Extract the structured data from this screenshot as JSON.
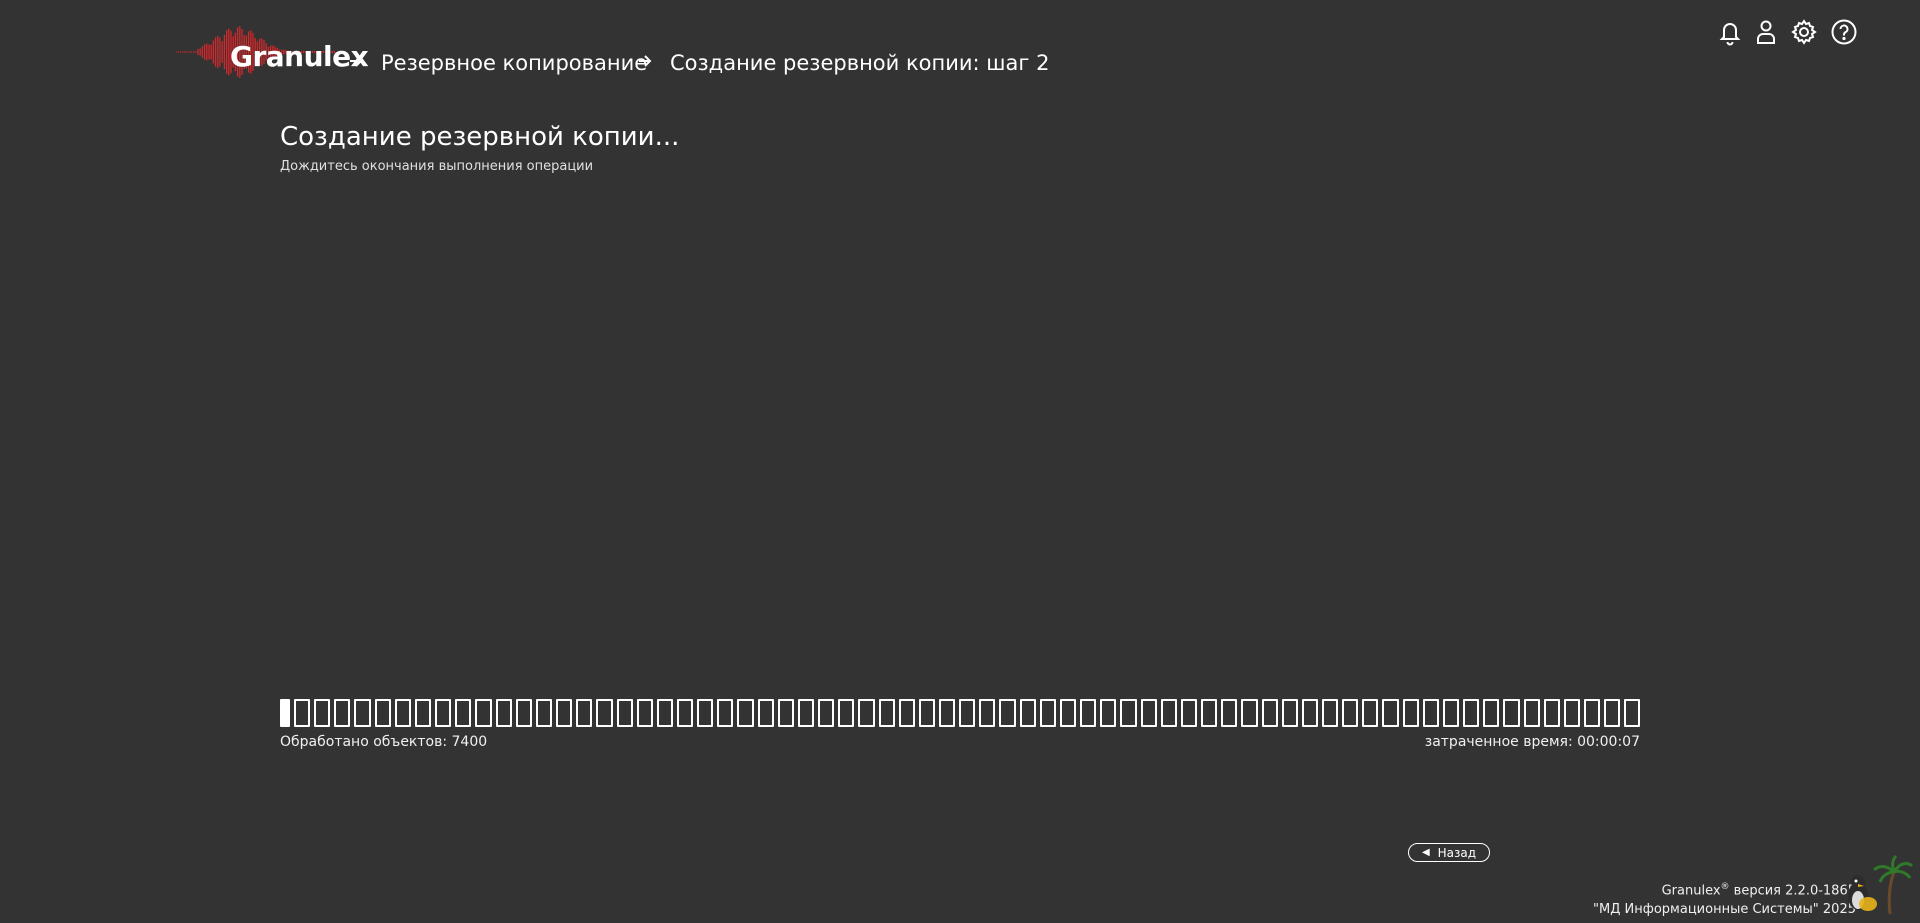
{
  "header": {
    "logo_text": "Granulex",
    "breadcrumb": [
      {
        "label": "Резервное копирование"
      },
      {
        "label": "Создание резервной копии: шаг 2"
      }
    ],
    "icons": [
      "bell-icon",
      "user-icon",
      "gear-icon",
      "help-icon"
    ]
  },
  "main": {
    "title": "Создание резервной копии...",
    "subtitle": "Дождитесь окончания выполнения операции",
    "progress": {
      "total_cells": 68,
      "filled_cells": 1,
      "processed_text": "Обработано объектов: 7400",
      "elapsed_text": "затраченное время: 00:00:07"
    },
    "back_button": {
      "label": "Назад",
      "icon": "triangle-left-icon"
    }
  },
  "footer": {
    "product": "Granulex",
    "registered": "®",
    "version_text": " версия 2.2.0-1865",
    "copyright": "\"МД Информационные Системы\" 2025"
  },
  "colors": {
    "background": "#333333",
    "foreground": "#ffffff",
    "brand_red": "#d6272b"
  }
}
